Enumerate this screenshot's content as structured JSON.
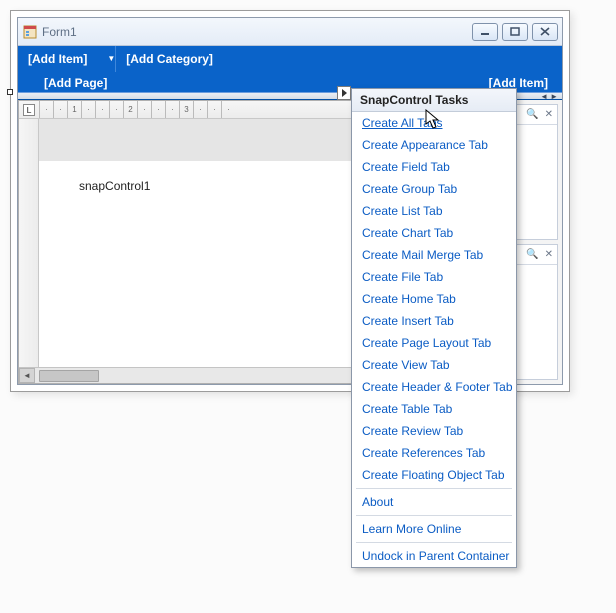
{
  "window": {
    "title": "Form1"
  },
  "ribbon": {
    "add_item": "[Add Item]",
    "add_category": "[Add Category]",
    "add_page": "[Add Page]",
    "add_item_right": "[Add Item]"
  },
  "document": {
    "control_name": "snapControl1",
    "ruler_numbers": [
      "1",
      "2",
      "3"
    ]
  },
  "tasks": {
    "title": "SnapControl Tasks",
    "items": [
      "Create All Tabs",
      "Create Appearance Tab",
      "Create Field Tab",
      "Create Group Tab",
      "Create List Tab",
      "Create Chart Tab",
      "Create Mail Merge Tab",
      "Create File Tab",
      "Create Home Tab",
      "Create Insert Tab",
      "Create Page Layout Tab",
      "Create View Tab",
      "Create Header & Footer Tab",
      "Create Table Tab",
      "Create Review Tab",
      "Create References Tab",
      "Create Floating Object Tab"
    ],
    "items2": [
      "About",
      "Learn More Online",
      "Undock in Parent Container"
    ]
  }
}
